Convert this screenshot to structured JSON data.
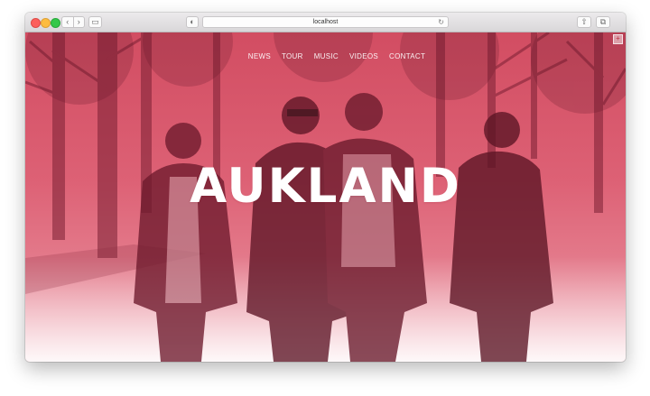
{
  "browser": {
    "url": "localhost",
    "back_glyph": "‹",
    "forward_glyph": "›",
    "reload_glyph": "↻",
    "share_glyph": "⇧",
    "tabs_glyph": "⧉",
    "sidebar_glyph": "▭",
    "shield_glyph": "◐"
  },
  "site": {
    "nav": [
      "NEWS",
      "TOUR",
      "MUSIC",
      "VIDEOS",
      "CONTACT"
    ],
    "title": "AUKLAND",
    "corner_glyph": "+"
  },
  "colors": {
    "overlay": "#d24d62",
    "overlay_light": "#f0a9b4",
    "text": "#ffffff"
  }
}
